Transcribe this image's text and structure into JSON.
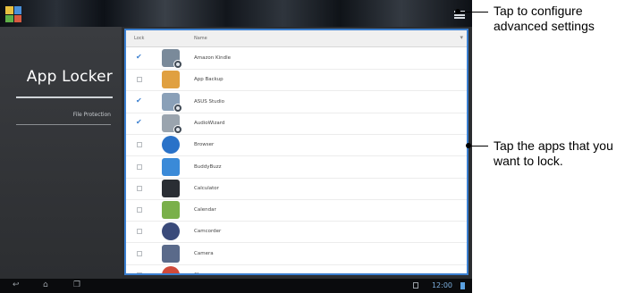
{
  "sidebar": {
    "title": "App Locker",
    "item": "File Protection"
  },
  "list": {
    "header": {
      "lock": "Lock",
      "name": "Name"
    },
    "rows": [
      {
        "name": "Amazon Kindle",
        "checked": true,
        "icon": "kindle-icon",
        "color": "#7a8a9a",
        "badge": true
      },
      {
        "name": "App Backup",
        "checked": false,
        "icon": "app-backup-icon",
        "color": "#e0a040",
        "badge": false
      },
      {
        "name": "ASUS Studio",
        "checked": true,
        "icon": "asus-studio-icon",
        "color": "#8aa0b8",
        "badge": true
      },
      {
        "name": "AudioWizard",
        "checked": true,
        "icon": "audiowizard-icon",
        "color": "#9aa4ae",
        "badge": true
      },
      {
        "name": "Browser",
        "checked": false,
        "icon": "browser-globe-icon",
        "color": "#2a72c8",
        "badge": false
      },
      {
        "name": "BuddyBuzz",
        "checked": false,
        "icon": "buddybuzz-icon",
        "color": "#3a8ad8",
        "badge": false
      },
      {
        "name": "Calculator",
        "checked": false,
        "icon": "calculator-icon",
        "color": "#2a2e34",
        "badge": false
      },
      {
        "name": "Calendar",
        "checked": false,
        "icon": "calendar-icon",
        "color": "#7ab04a",
        "badge": false
      },
      {
        "name": "Camcorder",
        "checked": false,
        "icon": "camcorder-icon",
        "color": "#3a4a7a",
        "badge": false
      },
      {
        "name": "Camera",
        "checked": false,
        "icon": "camera-icon",
        "color": "#5a6a8a",
        "badge": false
      },
      {
        "name": "Chrome",
        "checked": false,
        "icon": "chrome-icon",
        "color": "#d04a3a",
        "badge": false
      }
    ]
  },
  "statusbar": {
    "time": "12:00"
  },
  "callouts": {
    "settings": "Tap to configure advanced settings",
    "lock_apps": "Tap the apps that you want to lock."
  },
  "colors": {
    "accent": "#3b7fd0",
    "sidebar_bg": "#2c2e31"
  }
}
